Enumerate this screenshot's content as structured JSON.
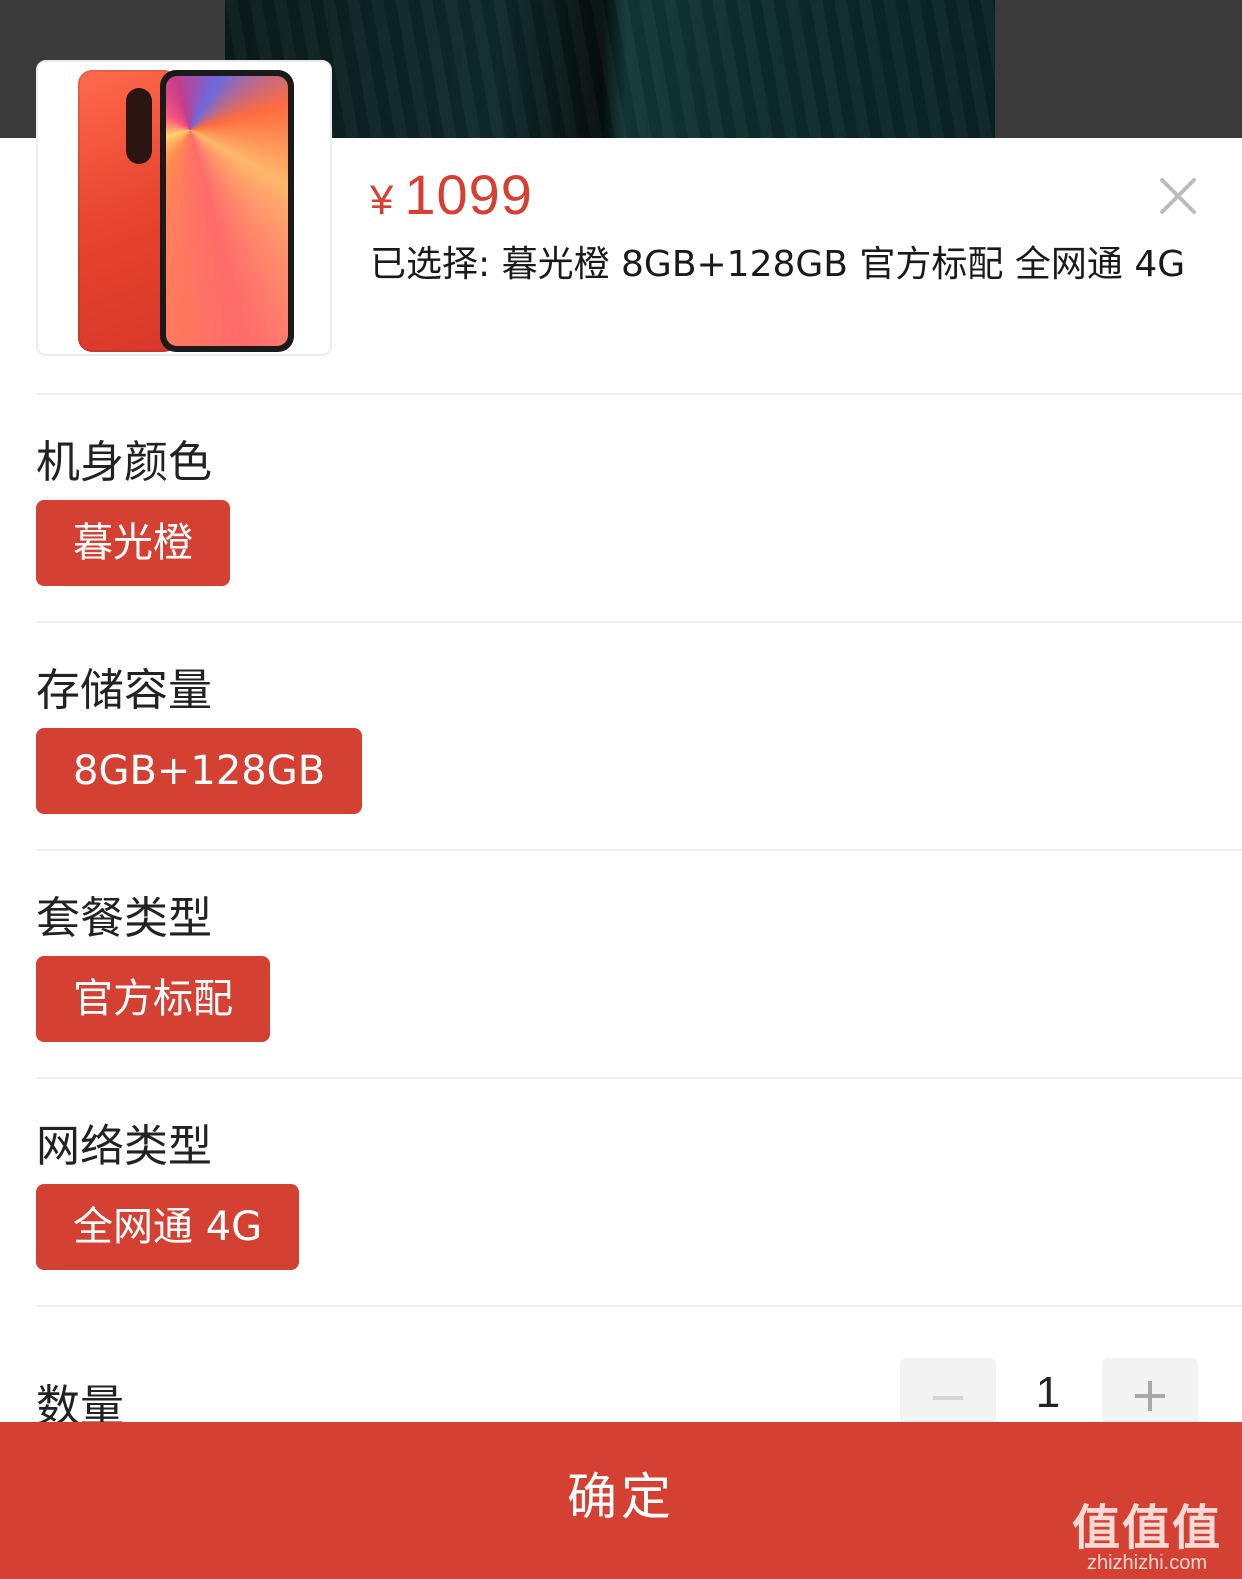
{
  "header": {
    "price_symbol": "¥",
    "price": "1099",
    "selected_text": "已选择: 暮光橙 8GB+128GB 官方标配 全网通 4G"
  },
  "sections": [
    {
      "title": "机身颜色",
      "option": "暮光橙"
    },
    {
      "title": "存储容量",
      "option": "8GB+128GB"
    },
    {
      "title": "套餐类型",
      "option": "官方标配"
    },
    {
      "title": "网络类型",
      "option": "全网通 4G"
    }
  ],
  "quantity": {
    "label": "数量",
    "value": "1",
    "minus_icon": "minus-icon",
    "plus_icon": "plus-icon"
  },
  "footer": {
    "confirm_label": "确定"
  },
  "watermark": {
    "logo": "值值值",
    "url": "zhizhizhi.com"
  },
  "colors": {
    "accent": "#d44133",
    "divider": "#efefef",
    "qty_button_bg": "#f3f3f3"
  }
}
